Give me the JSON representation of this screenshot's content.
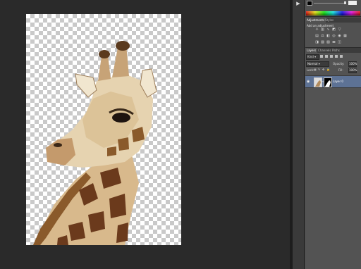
{
  "color_panel": {
    "slider_value": ""
  },
  "adjustments": {
    "tabs": [
      "Adjustments",
      "Styles"
    ],
    "title": "Add an adjustment",
    "icons_row1": [
      "brightness-icon",
      "levels-icon",
      "curves-icon",
      "exposure-icon",
      "vibrance-icon"
    ],
    "icons_row2": [
      "hue-sat-icon",
      "color-balance-icon",
      "bw-icon",
      "photo-filter-icon",
      "channel-mixer-icon",
      "color-lookup-icon"
    ],
    "icons_row3": [
      "invert-icon",
      "posterize-icon",
      "threshold-icon",
      "gradient-map-icon",
      "selective-color-icon"
    ]
  },
  "layers": {
    "tabs": [
      "Layers",
      "Channels",
      "Paths"
    ],
    "kind_label": "Kind",
    "blend_mode": "Normal",
    "opacity_label": "Opacity:",
    "opacity_value": "100%",
    "lock_label": "Lock:",
    "fill_label": "Fill:",
    "fill_value": "100%",
    "layer_name": "Layer 0"
  },
  "colors": {
    "selected_layer": "#5d7295",
    "panel_bg": "#535353"
  }
}
